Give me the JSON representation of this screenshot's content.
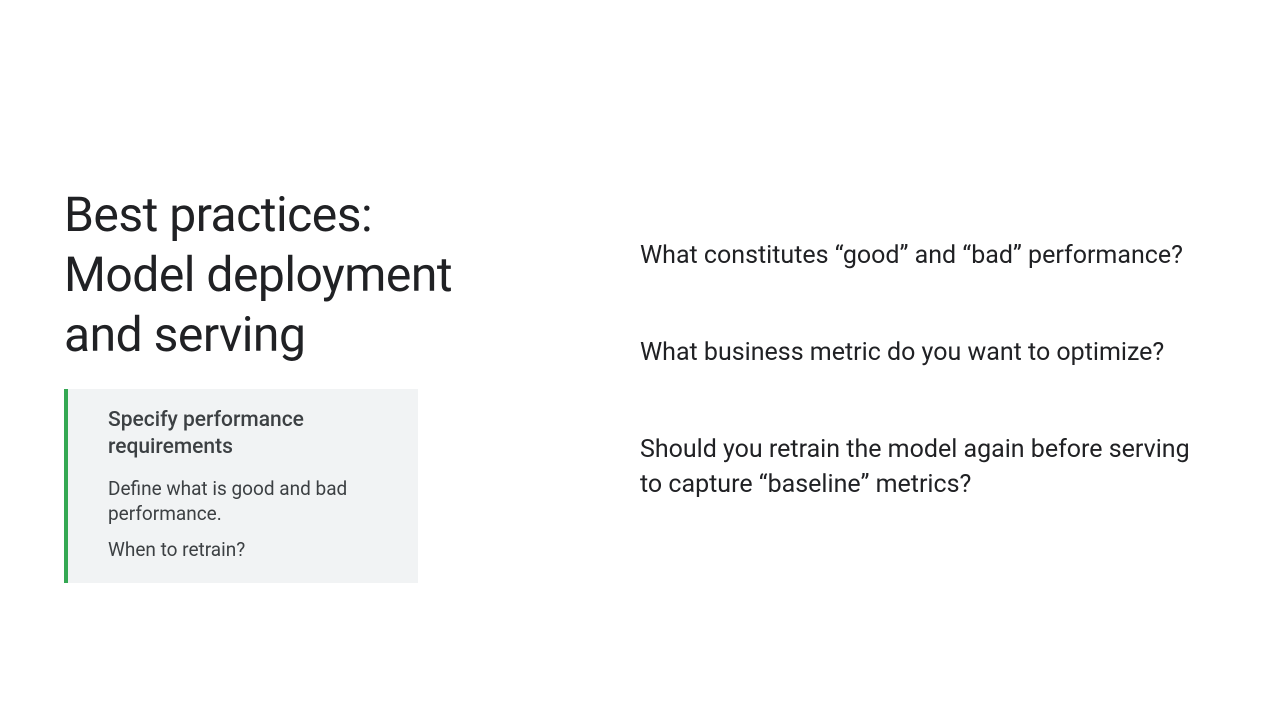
{
  "title_line1": "Best practices:",
  "title_line2": "Model deployment and serving",
  "callout": {
    "heading": "Specify performance requirements",
    "body1": "Define what is good and bad performance.",
    "body2": "When to retrain?"
  },
  "questions": {
    "q1": "What constitutes “good” and “bad” performance?",
    "q2": "What business metric do you want to optimize?",
    "q3": "Should you retrain the model again before serving to capture “baseline” metrics?"
  }
}
